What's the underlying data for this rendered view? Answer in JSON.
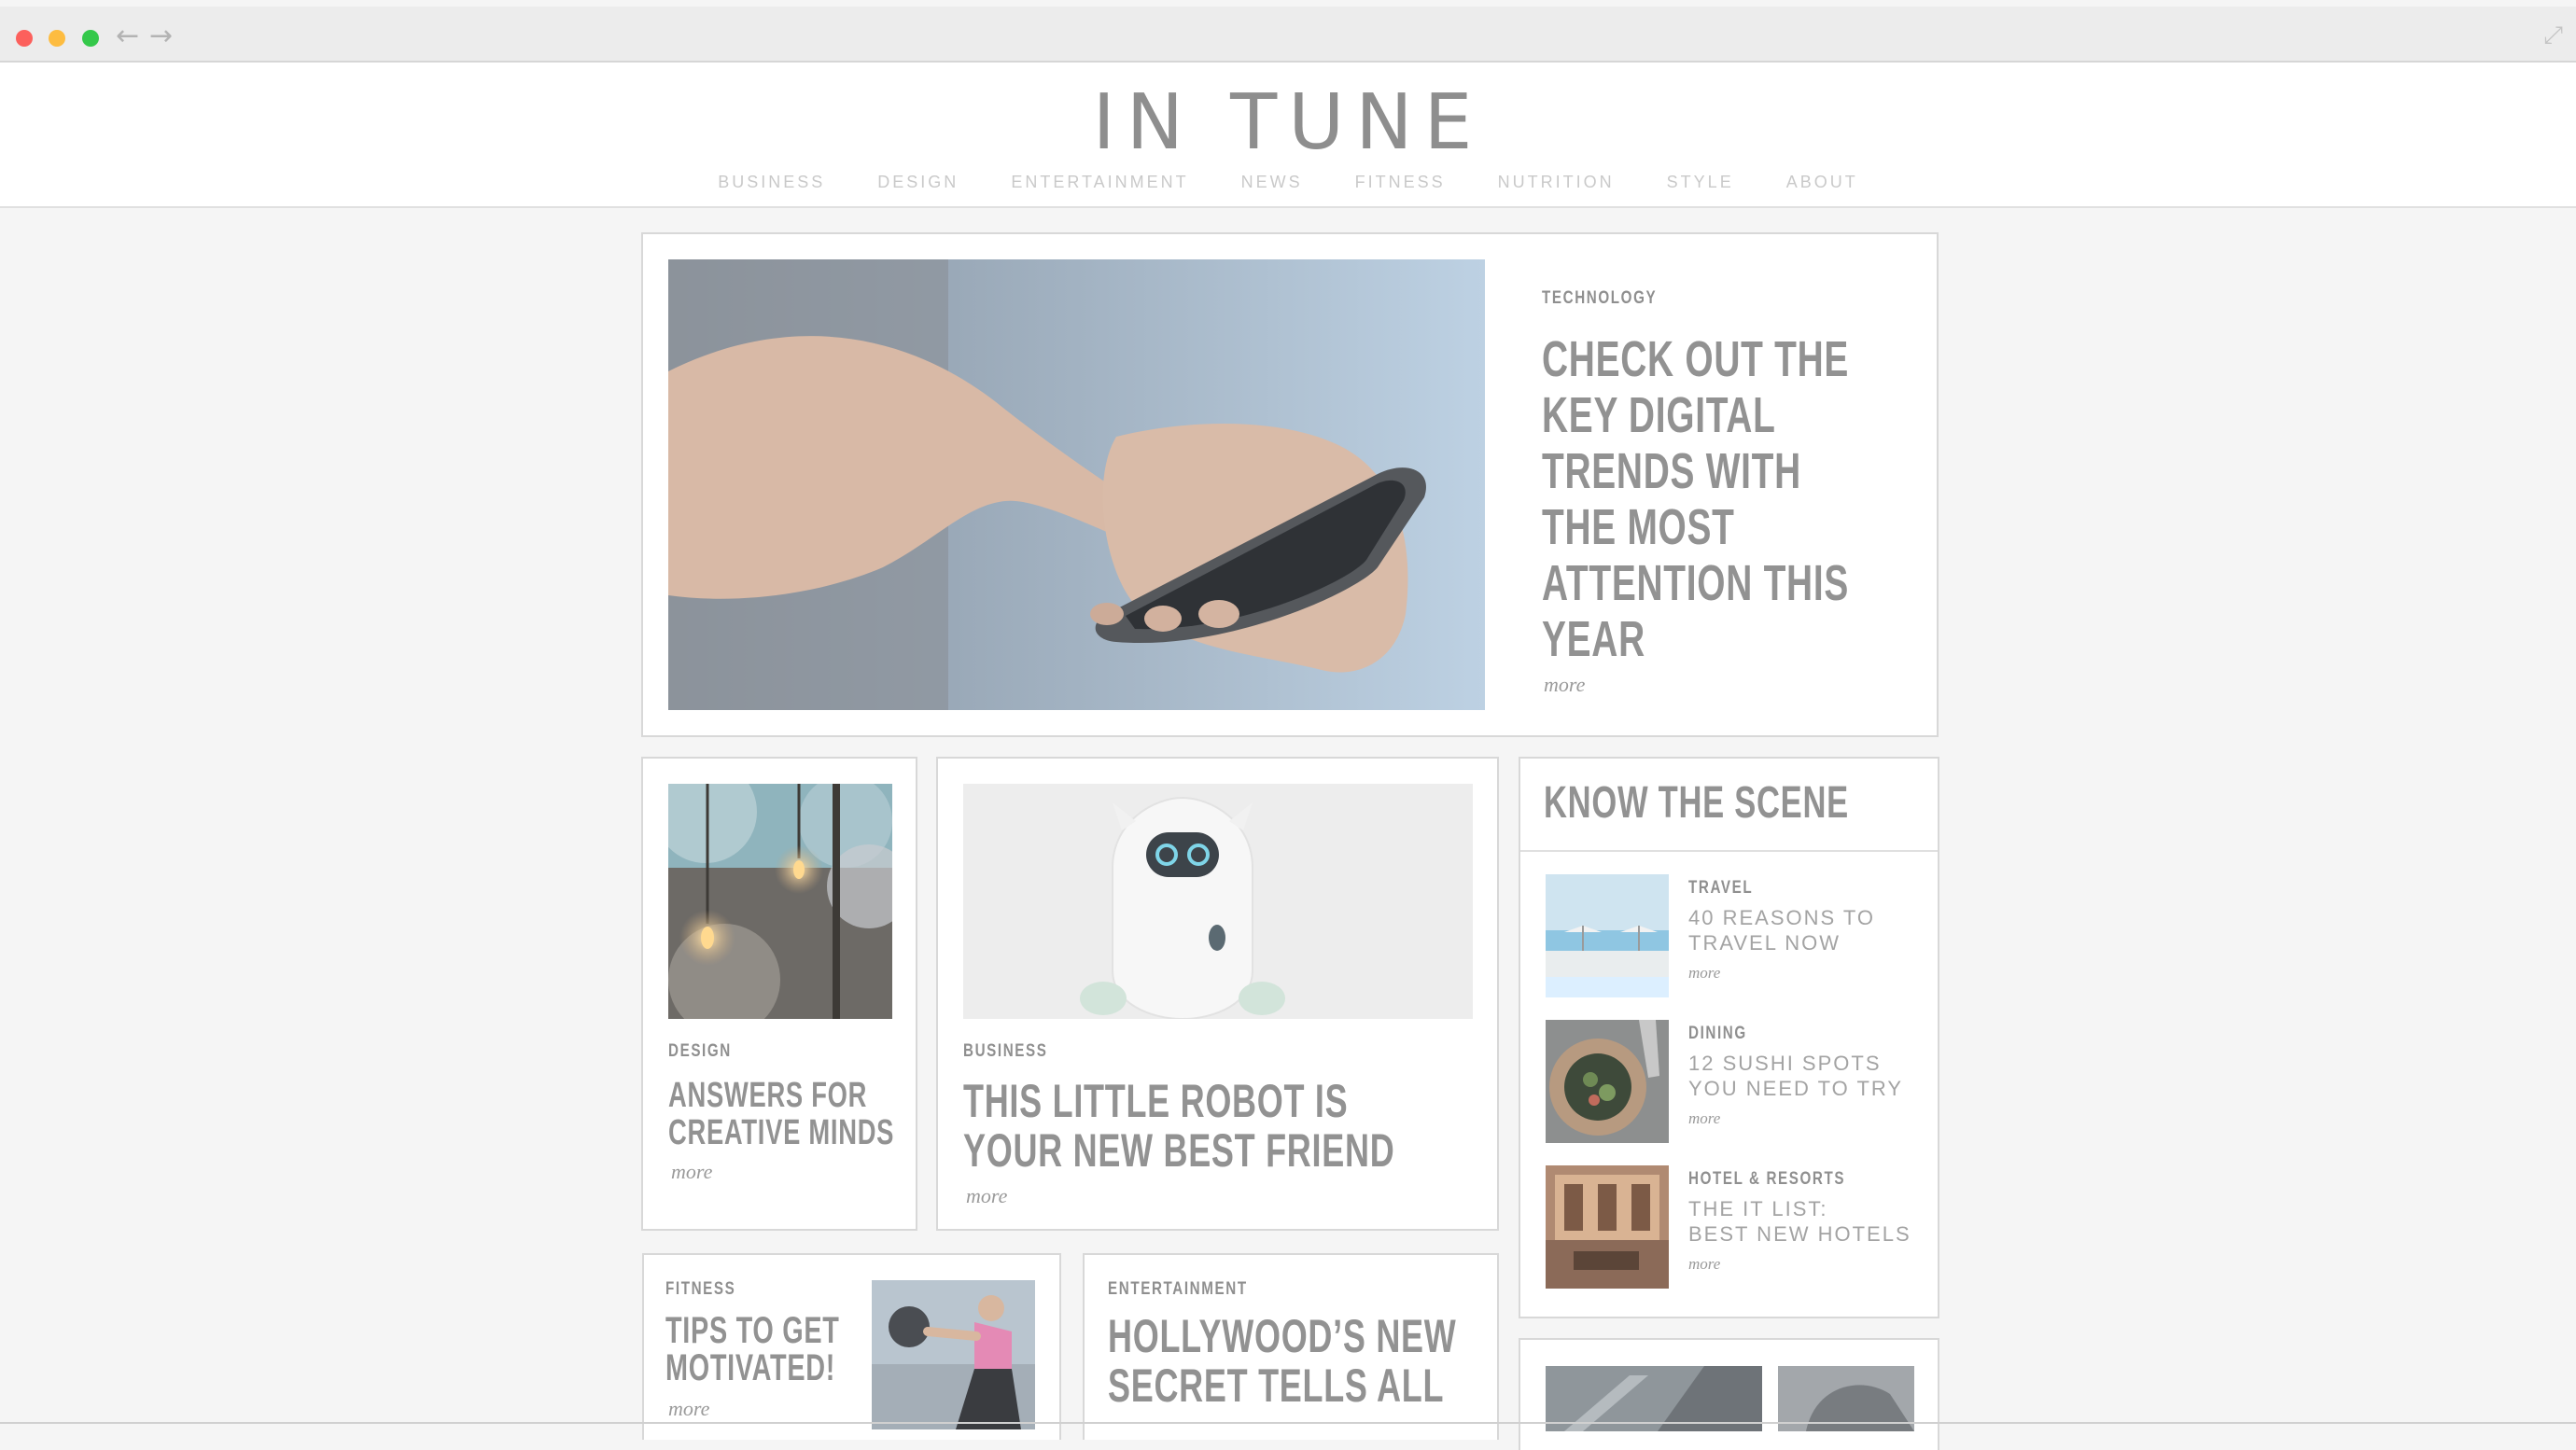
{
  "browser": {
    "back_icon": "←",
    "forward_icon": "→",
    "expand_icon": "⤢",
    "traffic_lights": [
      "#fc605c",
      "#fdbc40",
      "#34c84a"
    ]
  },
  "site": {
    "logo": "IN TUNE",
    "nav": [
      "BUSINESS",
      "DESIGN",
      "ENTERTAINMENT",
      "NEWS",
      "FITNESS",
      "NUTRITION",
      "STYLE",
      "ABOUT"
    ]
  },
  "hero": {
    "category": "TECHNOLOGY",
    "headline": "CHECK OUT THE KEY DIGITAL TRENDS WITH THE MOST ATTENTION THIS YEAR",
    "headline_lines": [
      "CHECK OUT THE",
      "KEY DIGITAL",
      "TRENDS WITH",
      "THE MOST",
      "ATTENTION THIS",
      "YEAR"
    ],
    "more": "more"
  },
  "design_card": {
    "category": "DESIGN",
    "headline_lines": [
      "ANSWERS FOR",
      "CREATIVE MINDS"
    ],
    "more": "more"
  },
  "business_card": {
    "category": "BUSINESS",
    "headline_lines": [
      "THIS LITTLE ROBOT IS",
      "YOUR NEW BEST FRIEND"
    ],
    "more": "more"
  },
  "scene": {
    "title": "KNOW THE SCENE",
    "items": [
      {
        "category": "TRAVEL",
        "title_lines": [
          "40 REASONS TO",
          "TRAVEL NOW"
        ],
        "more": "more"
      },
      {
        "category": "DINING",
        "title_lines": [
          "12 SUSHI SPOTS",
          "YOU NEED TO TRY"
        ],
        "more": "more"
      },
      {
        "category": "HOTEL & RESORTS",
        "title_lines": [
          "THE IT LIST:",
          "BEST NEW HOTELS"
        ],
        "more": "more"
      }
    ]
  },
  "fitness_card": {
    "category": "FITNESS",
    "headline_lines": [
      "TIPS TO GET",
      "MOTIVATED!"
    ],
    "more": "more"
  },
  "entertainment_card": {
    "category": "ENTERTAINMENT",
    "headline_lines": [
      "HOLLYWOOD’S NEW",
      "SECRET TELLS ALL"
    ]
  }
}
